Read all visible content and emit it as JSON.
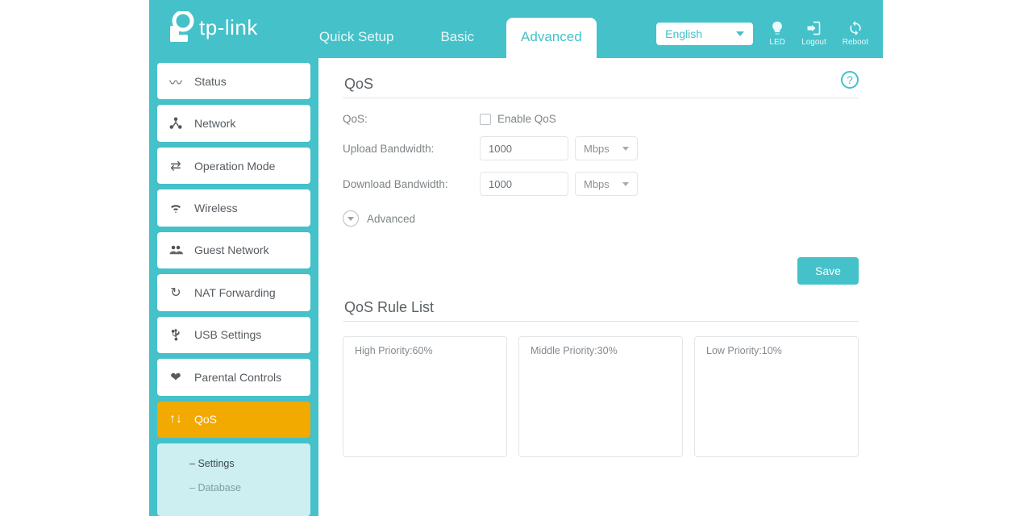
{
  "brand": "tp-link",
  "header": {
    "tabs": {
      "quick_setup": "Quick Setup",
      "basic": "Basic",
      "advanced": "Advanced"
    },
    "language": "English",
    "icons": {
      "led": "LED",
      "logout": "Logout",
      "reboot": "Reboot"
    }
  },
  "sidebar": {
    "items": {
      "status": "Status",
      "network": "Network",
      "operation_mode": "Operation Mode",
      "wireless": "Wireless",
      "guest_network": "Guest Network",
      "nat_forwarding": "NAT Forwarding",
      "usb_settings": "USB Settings",
      "parental_controls": "Parental Controls",
      "qos": "QoS"
    },
    "sub": {
      "settings": "Settings",
      "database": "Database"
    }
  },
  "qos": {
    "title": "QoS",
    "label_qos": "QoS:",
    "enable_label": "Enable QoS",
    "upload_label": "Upload Bandwidth:",
    "upload_value": "1000",
    "download_label": "Download Bandwidth:",
    "download_value": "1000",
    "unit": "Mbps",
    "advanced_toggle": "Advanced",
    "save": "Save",
    "rule_list_title": "QoS Rule List",
    "rules": {
      "high": "High Priority:60%",
      "middle": "Middle Priority:30%",
      "low": "Low Priority:10%"
    }
  },
  "colors": {
    "accent": "#44c1c9",
    "active": "#f2a900"
  }
}
